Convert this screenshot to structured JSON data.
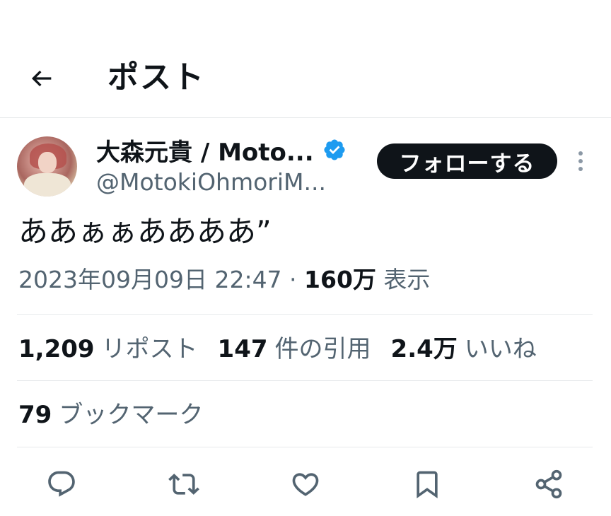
{
  "header": {
    "title": "ポスト"
  },
  "author": {
    "display_name": "大森元貴 / Moto...",
    "handle": "@MotokiOhmoriM...",
    "verified": true,
    "verified_color": "#1d9bf0"
  },
  "follow_button": {
    "label": "フォローする"
  },
  "tweet": {
    "text": "ああぁぁああああ”",
    "timestamp": "2023年09月09日 22:47",
    "separator": " · ",
    "views_count": "160万",
    "views_label": " 表示"
  },
  "stats": {
    "reposts_count": "1,209",
    "reposts_label": "リポスト",
    "quotes_count": "147",
    "quotes_label": "件の引用",
    "likes_count": "2.4万",
    "likes_label": "いいね",
    "bookmarks_count": "79",
    "bookmarks_label": "ブックマーク"
  },
  "actions": [
    {
      "icon": "reply-icon"
    },
    {
      "icon": "repost-icon"
    },
    {
      "icon": "like-icon"
    },
    {
      "icon": "bookmark-icon"
    },
    {
      "icon": "share-icon"
    }
  ],
  "colors": {
    "text_primary": "#0f1419",
    "text_secondary": "#536471",
    "divider": "#e6e9eb",
    "icon": "#536471"
  }
}
